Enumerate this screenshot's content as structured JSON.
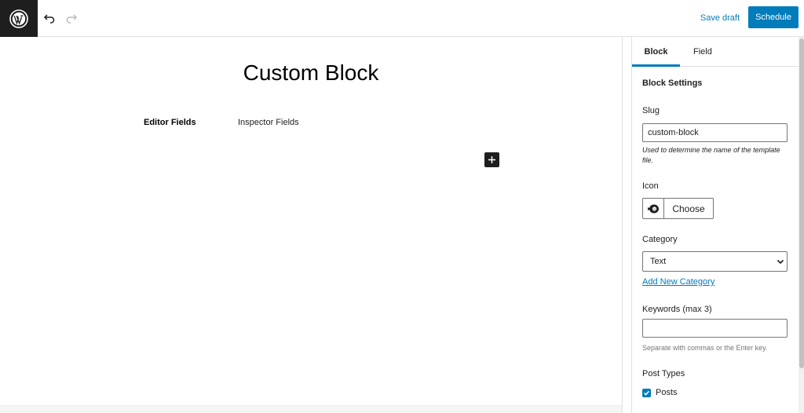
{
  "toolbar": {
    "logo_icon": "wordpress-logo-icon",
    "undo_icon": "undo-icon",
    "redo_icon": "redo-icon",
    "save_draft_label": "Save draft",
    "schedule_label": "Schedule"
  },
  "editor": {
    "block_title": "Custom Block",
    "tabs": [
      "Editor Fields",
      "Inspector Fields"
    ],
    "add_block_icon": "plus-icon"
  },
  "sidebar": {
    "tabs": [
      "Block",
      "Field"
    ],
    "active_tab": "Block",
    "section_title": "Block Settings",
    "slug": {
      "label": "Slug",
      "value": "custom-block",
      "help": "Used to determine the name of the template file."
    },
    "icon": {
      "label": "Icon",
      "preview_icon": "block-icon",
      "choose_label": "Choose"
    },
    "category": {
      "label": "Category",
      "selected": "Text",
      "add_link": "Add New Category"
    },
    "keywords": {
      "label": "Keywords (max 3)",
      "value": "",
      "help": "Separate with commas or the Enter key."
    },
    "post_types": {
      "label": "Post Types",
      "options": [
        {
          "label": "Posts",
          "checked": true
        }
      ]
    }
  },
  "colors": {
    "accent": "#007cba",
    "dark": "#1e1e1e"
  }
}
